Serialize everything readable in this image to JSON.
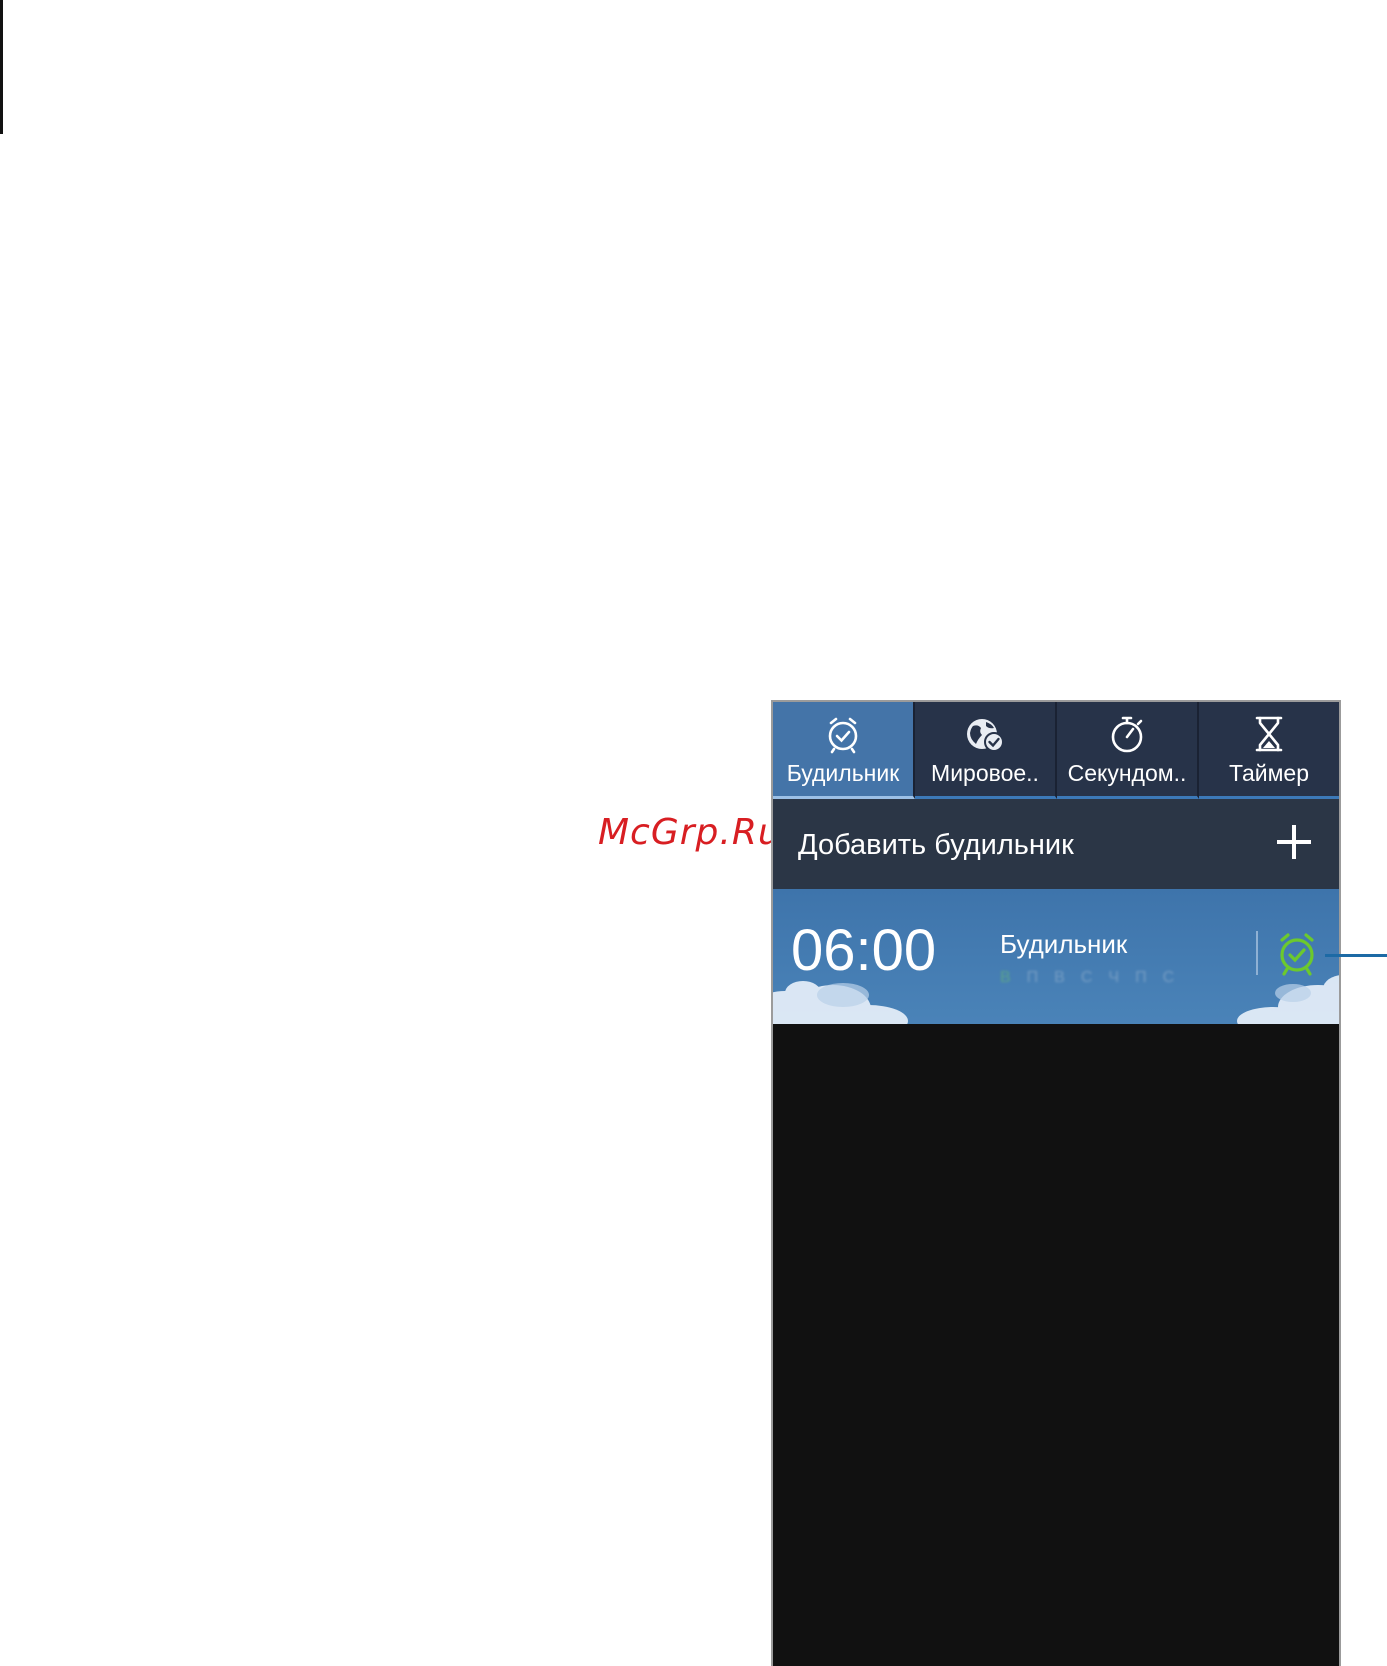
{
  "watermark": "McGrp.Ru",
  "tabs": [
    {
      "label": "Будильник",
      "icon": "alarm-clock-icon",
      "active": true
    },
    {
      "label": "Мировое..",
      "icon": "world-clock-icon",
      "active": false
    },
    {
      "label": "Секундом..",
      "icon": "stopwatch-icon",
      "active": false
    },
    {
      "label": "Таймер",
      "icon": "hourglass-icon",
      "active": false
    }
  ],
  "add_alarm": {
    "label": "Добавить будильник",
    "icon": "plus-icon"
  },
  "alarms": [
    {
      "time": "06:00",
      "name": "Будильник",
      "days": [
        "В",
        "П",
        "В",
        "С",
        "Ч",
        "П",
        "С"
      ],
      "enabled": true,
      "status_icon": "alarm-clock-icon"
    }
  ],
  "colors": {
    "tab_bar": "#273349",
    "tab_active": "#4474a8",
    "add_row": "#2b3646",
    "alarm_row": "#4474a8",
    "alarm_on": "#6cc92d",
    "screen_bg": "#111111",
    "watermark": "#d81e22"
  }
}
